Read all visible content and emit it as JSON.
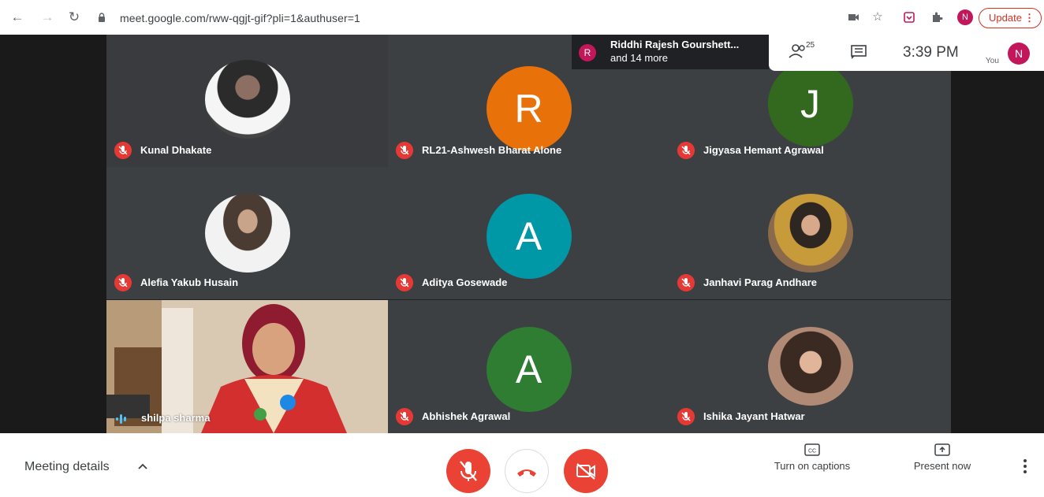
{
  "browser": {
    "url": "meet.google.com/rww-qgjt-gif?pli=1&authuser=1",
    "profile_initial": "N",
    "update_label": "Update"
  },
  "notification": {
    "avatar_initial": "R",
    "line1": "Riddhi Rajesh Gourshett...",
    "line2": "and 14 more"
  },
  "topbar": {
    "participant_count": "25",
    "time": "3:39 PM",
    "you_label": "You",
    "self_initial": "N"
  },
  "participants": [
    {
      "name": "Kunal Dhakate",
      "avatar": "photo",
      "muted": true
    },
    {
      "name": "RL21-Ashwesh Bharat Alone",
      "initial": "R",
      "color": "#e8710a",
      "muted": true
    },
    {
      "name": "Jigyasa Hemant Agrawal",
      "initial": "J",
      "color": "#33691e",
      "muted": true
    },
    {
      "name": "Alefia Yakub Husain",
      "avatar": "photo",
      "muted": true
    },
    {
      "name": "Aditya Gosewade",
      "initial": "A",
      "color": "#0097a7",
      "muted": true
    },
    {
      "name": "Janhavi Parag Andhare",
      "avatar": "photo",
      "muted": true
    },
    {
      "name": "shilpa sharma",
      "avatar": "video",
      "speaking": true
    },
    {
      "name": "Abhishek Agrawal",
      "initial": "A",
      "color": "#2e7d32",
      "muted": true
    },
    {
      "name": "Ishika Jayant Hatwar",
      "avatar": "photo",
      "muted": true
    }
  ],
  "bottom": {
    "meeting_details": "Meeting details",
    "captions_label": "Turn on captions",
    "present_label": "Present now"
  },
  "colors": {
    "danger": "#ea4335",
    "stage": "#202124",
    "tile": "#3c4043"
  }
}
